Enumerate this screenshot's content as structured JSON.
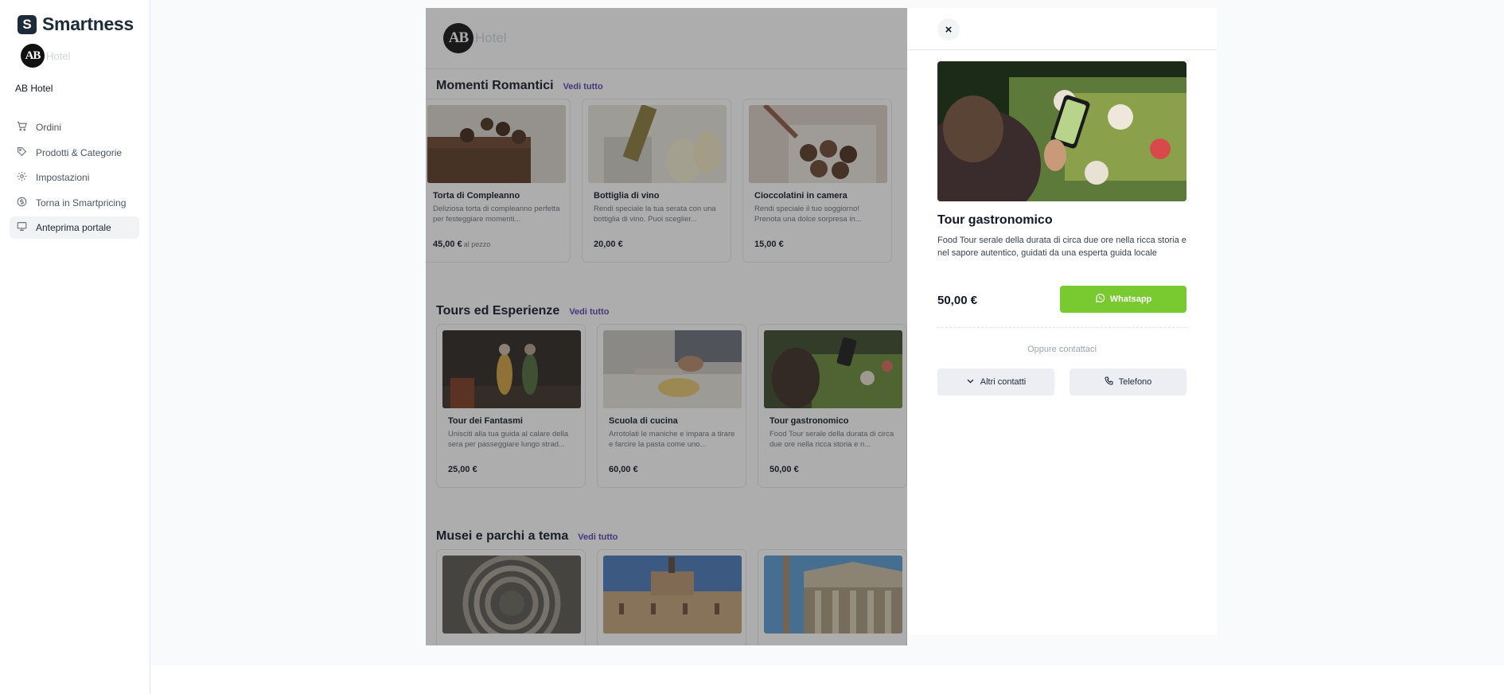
{
  "brand": {
    "name": "Smartness",
    "mark": "S"
  },
  "hotel": {
    "logo_initials": "AB",
    "logo_word": "Hotel",
    "name": "AB Hotel"
  },
  "nav": [
    {
      "label": "Ordini",
      "icon": "cart-icon",
      "active": false
    },
    {
      "label": "Prodotti & Categorie",
      "icon": "tag-icon",
      "active": false
    },
    {
      "label": "Impostazioni",
      "icon": "gear-icon",
      "active": false
    },
    {
      "label": "Torna in Smartpricing",
      "icon": "dollar-circle-icon",
      "active": false
    },
    {
      "label": "Anteprima portale",
      "icon": "monitor-icon",
      "active": true
    }
  ],
  "portal": {
    "sections": [
      {
        "title": "Momenti Romantici",
        "see_all": "Vedi tutto",
        "cards": [
          {
            "title": "Torta di Compleanno",
            "desc": "Deliziosa torta di compleanno perfetta per festeggiare momenti...",
            "price": "45,00 €",
            "unit": "al pezzo"
          },
          {
            "title": "Bottiglia di vino",
            "desc": "Rendi speciale la tua serata con una bottiglia di vino. Puoi sceglier...",
            "price": "20,00 €",
            "unit": ""
          },
          {
            "title": "Cioccolatini in camera",
            "desc": "Rendi speciale il tuo soggiorno! Prenota una dolce sorpresa in...",
            "price": "15,00 €",
            "unit": ""
          }
        ]
      },
      {
        "title": "Tours ed Esperienze",
        "see_all": "Vedi tutto",
        "cards": [
          {
            "title": "Tour dei Fantasmi",
            "desc": "Unisciti alla tua guida al calare della sera per passeggiare lungo strad...",
            "price": "25,00 €",
            "unit": ""
          },
          {
            "title": "Scuola di cucina",
            "desc": "Arrotolati le maniche e impara a tirare e farcire la pasta come uno...",
            "price": "60,00 €",
            "unit": ""
          },
          {
            "title": "Tour gastronomico",
            "desc": "Food Tour serale della durata di circa due ore nella ricca storia e n...",
            "price": "50,00 €",
            "unit": ""
          }
        ]
      },
      {
        "title": "Musei e parchi a tema",
        "see_all": "Vedi tutto",
        "cards": [
          {
            "title": "",
            "desc": "",
            "price": "",
            "unit": ""
          },
          {
            "title": "",
            "desc": "",
            "price": "",
            "unit": ""
          },
          {
            "title": "",
            "desc": "",
            "price": "",
            "unit": ""
          }
        ]
      }
    ]
  },
  "drawer": {
    "title": "Tour gastronomico",
    "description": "Food Tour serale della durata di circa due ore nella ricca storia e nel sapore autentico, guidati da una esperta guida locale",
    "price": "50,00 €",
    "whatsapp_label": "Whatsapp",
    "or_contact": "Oppure contattaci",
    "other_contacts_label": "Altri contatti",
    "phone_label": "Telefono",
    "close_icon": "×"
  },
  "colors": {
    "whatsapp_green": "#79c930",
    "link_purple": "#5b3fb0",
    "brand_dark": "#1d2b3a"
  }
}
